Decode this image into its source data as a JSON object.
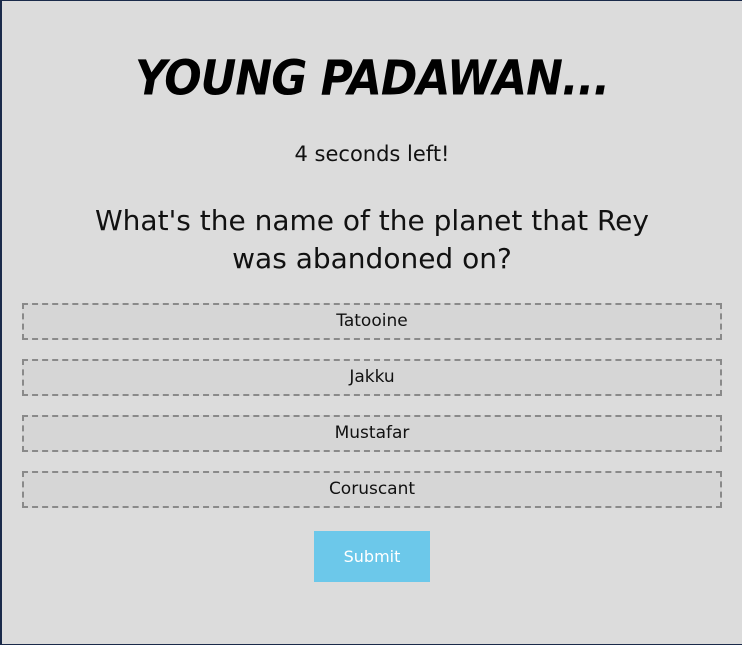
{
  "header": {
    "title": "YOUNG PADAWAN..."
  },
  "timer": {
    "text": "4 seconds left!"
  },
  "question": {
    "text": "What's the name of the planet that Rey was abandoned on?"
  },
  "answers": [
    {
      "label": "Tatooine"
    },
    {
      "label": "Jakku"
    },
    {
      "label": "Mustafar"
    },
    {
      "label": "Coruscant"
    }
  ],
  "submit": {
    "label": "Submit"
  },
  "colors": {
    "background": "#dcdcdc",
    "submit_button": "#6cc8ea",
    "answer_border": "#8a8a8a"
  }
}
